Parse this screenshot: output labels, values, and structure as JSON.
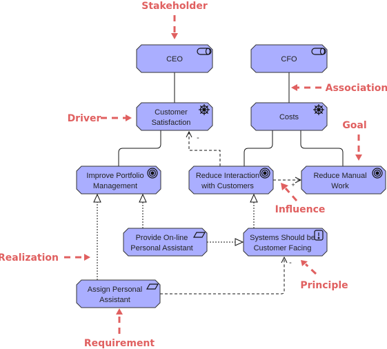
{
  "colors": {
    "node_fill": "#aaaeff",
    "annotation": "#e06060"
  },
  "nodes": {
    "ceo": {
      "lines": [
        "CEO"
      ],
      "type": "stakeholder",
      "icon": "stakeholder-icon"
    },
    "cfo": {
      "lines": [
        "CFO"
      ],
      "type": "stakeholder",
      "icon": "stakeholder-icon"
    },
    "customer_satisfaction": {
      "lines": [
        "Customer",
        "Satisfaction"
      ],
      "type": "driver",
      "icon": "driver-icon"
    },
    "costs": {
      "lines": [
        "Costs"
      ],
      "type": "driver",
      "icon": "driver-icon"
    },
    "improve_portfolio": {
      "lines": [
        "Improve Portfolio",
        "Management"
      ],
      "type": "goal",
      "icon": "goal-icon"
    },
    "reduce_interaction": {
      "lines": [
        "Reduce Interaction",
        "with Customers"
      ],
      "type": "goal",
      "icon": "goal-icon"
    },
    "reduce_manual": {
      "lines": [
        "Reduce Manual",
        "Work"
      ],
      "type": "goal",
      "icon": "goal-icon"
    },
    "provide_online": {
      "lines": [
        "Provide On-line",
        "Personal Assistant"
      ],
      "type": "requirement",
      "icon": "requirement-icon"
    },
    "systems_facing": {
      "lines": [
        "Systems Should be",
        "Customer Facing"
      ],
      "type": "principle",
      "icon": "principle-icon"
    },
    "assign_assistant": {
      "lines": [
        "Assign Personal",
        "Assistant"
      ],
      "type": "requirement",
      "icon": "requirement-icon"
    }
  },
  "connector_labels": {
    "cs_influence": "-",
    "rm_influence": "+",
    "sys_influence": "-"
  },
  "annotations": {
    "stakeholder": "Stakeholder",
    "association": "Association",
    "driver": "Driver",
    "goal": "Goal",
    "influence": "Influence",
    "realization": "Realization",
    "principle": "Principle",
    "requirement": "Requirement"
  }
}
